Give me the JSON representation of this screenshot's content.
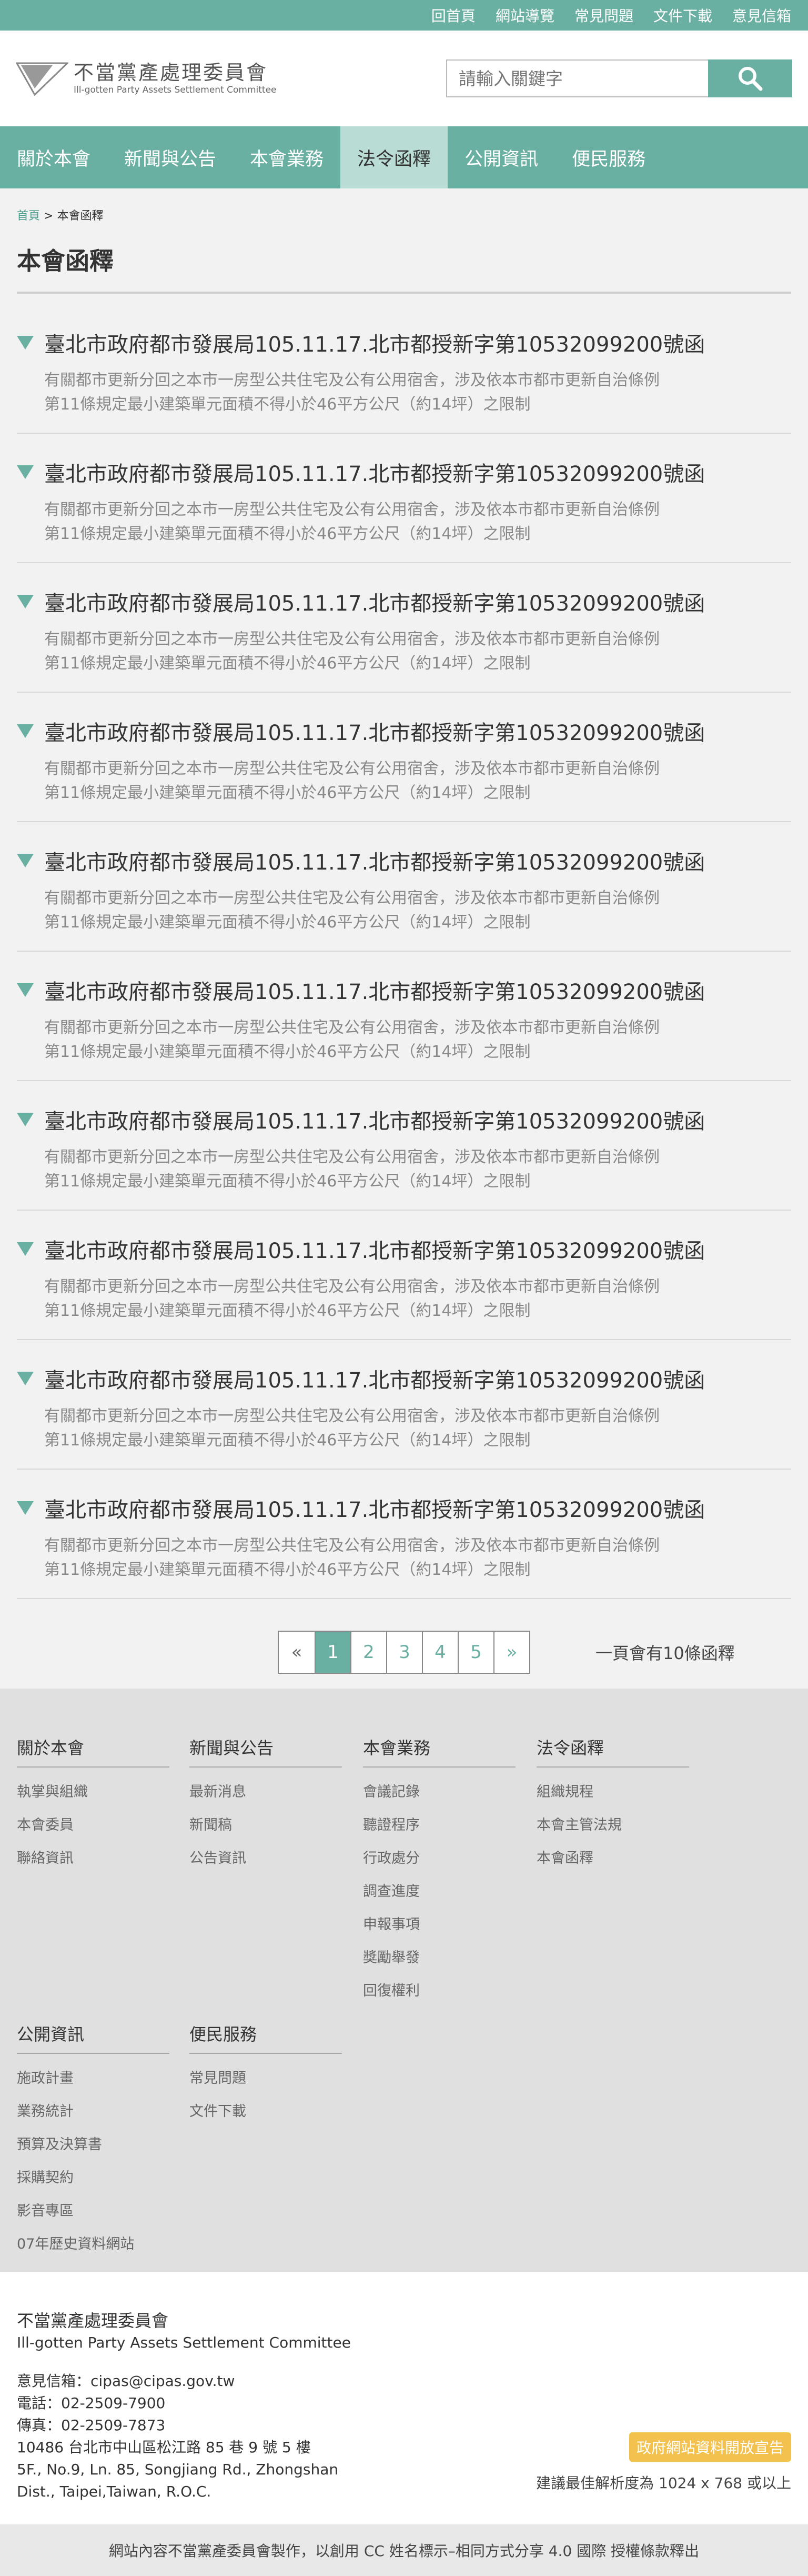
{
  "topbar": {
    "links": [
      "回首頁",
      "網站導覽",
      "常見問題",
      "文件下載",
      "意見信箱"
    ]
  },
  "header": {
    "org_cn": "不當黨產處理委員會",
    "org_en": "Ill-gotten Party Assets Settlement Committee",
    "search_placeholder": "請輸入關鍵字"
  },
  "nav": {
    "items": [
      "關於本會",
      "新聞與公告",
      "本會業務",
      "法令函釋",
      "公開資訊",
      "便民服務"
    ],
    "active_index": 3
  },
  "breadcrumb": {
    "home": "首頁",
    "separator": ">",
    "current": "本會函釋"
  },
  "page_title": "本會函釋",
  "items": [
    {
      "title": "臺北市政府都市發展局105.11.17.北市都授新字第10532099200號函",
      "desc1": "有關都市更新分回之本市一房型公共住宅及公有公用宿舍，涉及依本市都市更新自治條例",
      "desc2": "第11條規定最小建築單元面積不得小於46平方公尺（約14坪）之限制"
    },
    {
      "title": "臺北市政府都市發展局105.11.17.北市都授新字第10532099200號函",
      "desc1": "有關都市更新分回之本市一房型公共住宅及公有公用宿舍，涉及依本市都市更新自治條例",
      "desc2": "第11條規定最小建築單元面積不得小於46平方公尺（約14坪）之限制"
    },
    {
      "title": "臺北市政府都市發展局105.11.17.北市都授新字第10532099200號函",
      "desc1": "有關都市更新分回之本市一房型公共住宅及公有公用宿舍，涉及依本市都市更新自治條例",
      "desc2": "第11條規定最小建築單元面積不得小於46平方公尺（約14坪）之限制"
    },
    {
      "title": "臺北市政府都市發展局105.11.17.北市都授新字第10532099200號函",
      "desc1": "有關都市更新分回之本市一房型公共住宅及公有公用宿舍，涉及依本市都市更新自治條例",
      "desc2": "第11條規定最小建築單元面積不得小於46平方公尺（約14坪）之限制"
    },
    {
      "title": "臺北市政府都市發展局105.11.17.北市都授新字第10532099200號函",
      "desc1": "有關都市更新分回之本市一房型公共住宅及公有公用宿舍，涉及依本市都市更新自治條例",
      "desc2": "第11條規定最小建築單元面積不得小於46平方公尺（約14坪）之限制"
    },
    {
      "title": "臺北市政府都市發展局105.11.17.北市都授新字第10532099200號函",
      "desc1": "有關都市更新分回之本市一房型公共住宅及公有公用宿舍，涉及依本市都市更新自治條例",
      "desc2": "第11條規定最小建築單元面積不得小於46平方公尺（約14坪）之限制"
    },
    {
      "title": "臺北市政府都市發展局105.11.17.北市都授新字第10532099200號函",
      "desc1": "有關都市更新分回之本市一房型公共住宅及公有公用宿舍，涉及依本市都市更新自治條例",
      "desc2": "第11條規定最小建築單元面積不得小於46平方公尺（約14坪）之限制"
    },
    {
      "title": "臺北市政府都市發展局105.11.17.北市都授新字第10532099200號函",
      "desc1": "有關都市更新分回之本市一房型公共住宅及公有公用宿舍，涉及依本市都市更新自治條例",
      "desc2": "第11條規定最小建築單元面積不得小於46平方公尺（約14坪）之限制"
    },
    {
      "title": "臺北市政府都市發展局105.11.17.北市都授新字第10532099200號函",
      "desc1": "有關都市更新分回之本市一房型公共住宅及公有公用宿舍，涉及依本市都市更新自治條例",
      "desc2": "第11條規定最小建築單元面積不得小於46平方公尺（約14坪）之限制"
    },
    {
      "title": "臺北市政府都市發展局105.11.17.北市都授新字第10532099200號函",
      "desc1": "有關都市更新分回之本市一房型公共住宅及公有公用宿舍，涉及依本市都市更新自治條例",
      "desc2": "第11條規定最小建築單元面積不得小於46平方公尺（約14坪）之限制"
    }
  ],
  "pagination": {
    "prev": "«",
    "pages": [
      "1",
      "2",
      "3",
      "4",
      "5"
    ],
    "next": "»",
    "current": "1",
    "per_page_text": "一頁會有10條函釋"
  },
  "sitemap": [
    {
      "title": "關於本會",
      "links": [
        "執掌與組織",
        "本會委員",
        "聯絡資訊"
      ]
    },
    {
      "title": "新聞與公告",
      "links": [
        "最新消息",
        "新聞稿",
        "公告資訊"
      ]
    },
    {
      "title": "本會業務",
      "links": [
        "會議記錄",
        "聽證程序",
        "行政處分",
        "調查進度",
        "申報事項",
        "獎勵舉發",
        "回復權利"
      ]
    },
    {
      "title": "法令函釋",
      "links": [
        "組織規程",
        "本會主管法規",
        "本會函釋"
      ]
    },
    {
      "title": "公開資訊",
      "links": [
        "施政計畫",
        "業務統計",
        "預算及決算書",
        "採購契約",
        "影音專區",
        "07年歷史資料網站"
      ]
    },
    {
      "title": "便民服務",
      "links": [
        "常見問題",
        "文件下載"
      ]
    }
  ],
  "footer": {
    "org_cn": "不當黨產處理委員會",
    "org_en": "Ill-gotten Party Assets Settlement Committee",
    "email": "意見信箱：cipas@cipas.gov.tw",
    "phone": "電話：02-2509-7900",
    "fax": "傳真：02-2509-7873",
    "addr1": "10486 台北市中山區松江路 85 巷 9 號 5 樓",
    "addr2": "5F., No.9, Ln. 85, Songjiang Rd., Zhongshan",
    "addr3": "Dist., Taipei,Taiwan, R.O.C.",
    "open_data_badge": "政府網站資料開放宣告",
    "resolution": "建議最佳解析度為 1024 x 768 或以上",
    "license": "網站內容不當黨產委員會製作，以創用 CC 姓名標示–相同方式分享 4.0 國際 授權條款釋出"
  },
  "colors": {
    "accent": "#6ab0a2",
    "active_nav": "#b9dcd5",
    "badge": "#f2c14e"
  }
}
